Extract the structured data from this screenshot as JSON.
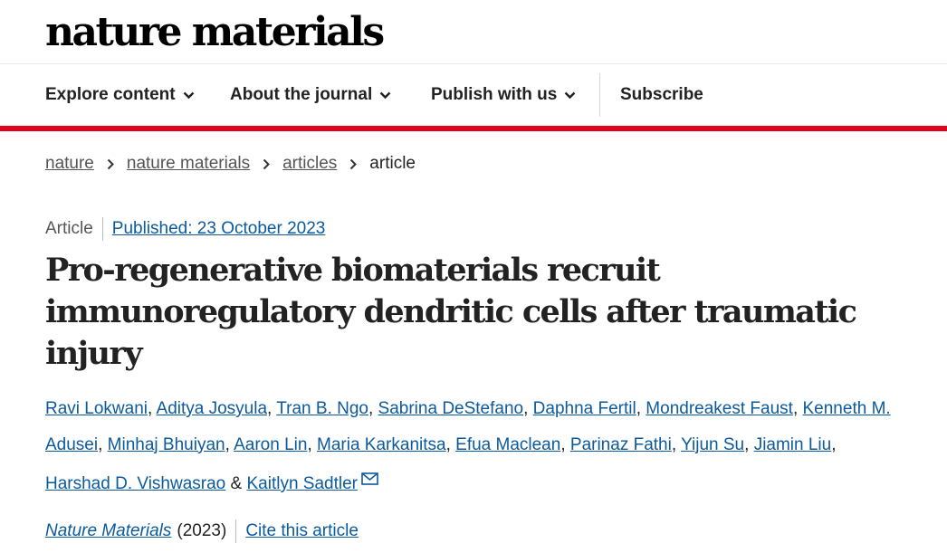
{
  "header": {
    "logo_text": "nature materials"
  },
  "nav": {
    "items": [
      {
        "label": "Explore content",
        "icon": "chevron-down-icon"
      },
      {
        "label": "About the journal",
        "icon": "chevron-down-icon"
      },
      {
        "label": "Publish with us",
        "icon": "chevron-down-icon"
      },
      {
        "label": "Subscribe"
      }
    ]
  },
  "breadcrumb": {
    "items": [
      "nature",
      "nature materials",
      "articles",
      "article"
    ]
  },
  "article": {
    "type": "Article",
    "published": "Published: 23 October 2023",
    "title": "Pro-regenerative biomaterials recruit immunoregulatory dendritic cells after traumatic injury",
    "authors": [
      "Ravi Lokwani",
      "Aditya Josyula",
      "Tran B. Ngo",
      "Sabrina DeStefano",
      "Daphna Fertil",
      "Mondreakest Faust",
      "Kenneth M. Adusei",
      "Minhaj Bhuiyan",
      "Aaron Lin",
      "Maria Karkanitsa",
      "Efua Maclean",
      "Parinaz Fathi",
      "Yijun Su",
      "Jiamin Liu",
      "Harshad D. Vishwasrao",
      "Kaitlyn Sadtler"
    ],
    "authors_joiner": "&",
    "journal": "Nature Materials",
    "year": "(2023)",
    "cite_label": "Cite this article",
    "mail_icon": "mail-icon"
  },
  "colors": {
    "accent_red": "#e3001b",
    "link_blue": "#0b5a9d",
    "text": "#222222"
  }
}
